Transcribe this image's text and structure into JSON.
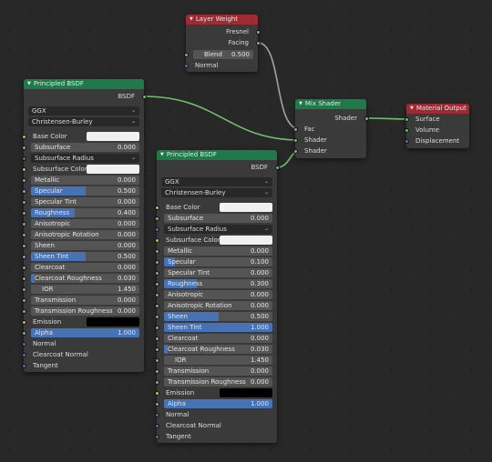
{
  "nodes": {
    "layer_weight": {
      "title": "Layer Weight",
      "out_fresnel": "Fresnel",
      "out_facing": "Facing",
      "blend_label": "Blend",
      "blend_value": "0.500",
      "blend_fraction": 0.5,
      "in_normal": "Normal"
    },
    "mix_shader": {
      "title": "Mix Shader",
      "out_shader": "Shader",
      "in_fac": "Fac",
      "in_shader_1": "Shader",
      "in_shader_2": "Shader"
    },
    "material_output": {
      "title": "Material Output",
      "in_surface": "Surface",
      "in_volume": "Volume",
      "in_displacement": "Displacement"
    },
    "principled_1": {
      "title": "Principled BSDF",
      "out_bsdf": "BSDF",
      "distribution": "GGX",
      "subsurface_method": "Christensen-Burley",
      "base_color": "Base Color",
      "subsurface": {
        "label": "Subsurface",
        "value": "0.000",
        "fraction": 0
      },
      "subsurface_radius": "Subsurface Radius",
      "subsurface_color": "Subsurface Color",
      "metallic": {
        "label": "Metallic",
        "value": "0.000",
        "fraction": 0
      },
      "specular": {
        "label": "Specular",
        "value": "0.500",
        "fraction": 0.5
      },
      "specular_tint": {
        "label": "Specular Tint",
        "value": "0.000",
        "fraction": 0
      },
      "roughness": {
        "label": "Roughness",
        "value": "0.400",
        "fraction": 0.4
      },
      "anisotropic": {
        "label": "Anisotropic",
        "value": "0.000",
        "fraction": 0
      },
      "anisotropic_rotation": {
        "label": "Anisotropic Rotation",
        "value": "0.000",
        "fraction": 0
      },
      "sheen": {
        "label": "Sheen",
        "value": "0.000",
        "fraction": 0
      },
      "sheen_tint": {
        "label": "Sheen Tint",
        "value": "0.500",
        "fraction": 0.5
      },
      "clearcoat": {
        "label": "Clearcoat",
        "value": "0.000",
        "fraction": 0
      },
      "clearcoat_roughness": {
        "label": "Clearcoat Roughness",
        "value": "0.030",
        "fraction": 0.03
      },
      "ior": {
        "label": "IOR",
        "value": "1.450",
        "fraction": 0
      },
      "transmission": {
        "label": "Transmission",
        "value": "0.000",
        "fraction": 0
      },
      "transmission_roughness": {
        "label": "Transmission Roughness",
        "value": "0.000",
        "fraction": 0
      },
      "emission": "Emission",
      "alpha": {
        "label": "Alpha",
        "value": "1.000",
        "fraction": 1
      },
      "normal": "Normal",
      "clearcoat_normal": "Clearcoat Normal",
      "tangent": "Tangent"
    },
    "principled_2": {
      "title": "Principled BSDF",
      "out_bsdf": "BSDF",
      "distribution": "GGX",
      "subsurface_method": "Christensen-Burley",
      "base_color": "Base Color",
      "subsurface": {
        "label": "Subsurface",
        "value": "0.000",
        "fraction": 0
      },
      "subsurface_radius": "Subsurface Radius",
      "subsurface_color": "Subsurface Color",
      "metallic": {
        "label": "Metallic",
        "value": "0.000",
        "fraction": 0
      },
      "specular": {
        "label": "Specular",
        "value": "0.100",
        "fraction": 0.1
      },
      "specular_tint": {
        "label": "Specular Tint",
        "value": "0.000",
        "fraction": 0
      },
      "roughness": {
        "label": "Roughness",
        "value": "0.300",
        "fraction": 0.3
      },
      "anisotropic": {
        "label": "Anisotropic",
        "value": "0.000",
        "fraction": 0
      },
      "anisotropic_rotation": {
        "label": "Anisotropic Rotation",
        "value": "0.000",
        "fraction": 0
      },
      "sheen": {
        "label": "Sheen",
        "value": "0.500",
        "fraction": 0.5
      },
      "sheen_tint": {
        "label": "Sheen Tint",
        "value": "1.000",
        "fraction": 1
      },
      "clearcoat": {
        "label": "Clearcoat",
        "value": "0.000",
        "fraction": 0
      },
      "clearcoat_roughness": {
        "label": "Clearcoat Roughness",
        "value": "0.030",
        "fraction": 0.03
      },
      "ior": {
        "label": "IOR",
        "value": "1.450",
        "fraction": 0
      },
      "transmission": {
        "label": "Transmission",
        "value": "0.000",
        "fraction": 0
      },
      "transmission_roughness": {
        "label": "Transmission Roughness",
        "value": "0.000",
        "fraction": 0
      },
      "emission": "Emission",
      "alpha": {
        "label": "Alpha",
        "value": "1.000",
        "fraction": 1
      },
      "normal": "Normal",
      "clearcoat_normal": "Clearcoat Normal",
      "tangent": "Tangent"
    }
  },
  "colors": {
    "shader_header": "#1f7a4a",
    "output_header": "#9e2a33",
    "slider_fill": "#4772b3",
    "socket_shader": "#63c763",
    "socket_color": "#c7c729",
    "socket_value": "#9e9e9e",
    "socket_vector": "#6363c7"
  }
}
